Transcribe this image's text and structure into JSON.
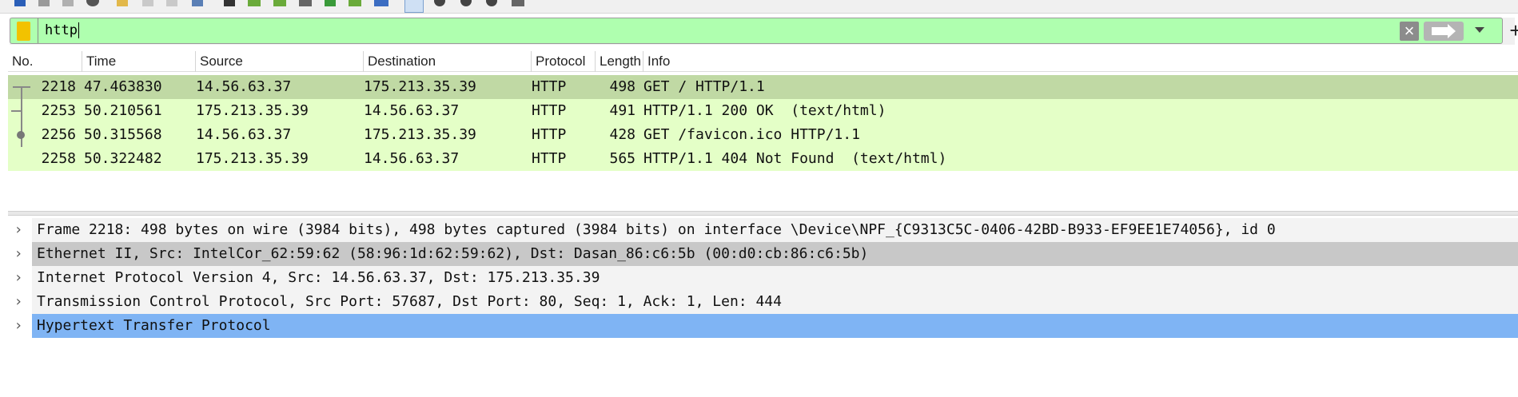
{
  "colors": {
    "filter_valid_bg": "#afffaf",
    "row_http_bg": "#e4ffc7",
    "row_selected_bg": "#c0d9a4",
    "detail_selected_bg": "#7fb4f4",
    "detail_highlight_bg": "#c8c8c8"
  },
  "toolbar": {
    "icons": [
      "shark-fin-icon",
      "stop-icon",
      "restart-icon",
      "options-icon",
      "open-icon",
      "save-icon",
      "close-file-icon",
      "reload-icon",
      "find-icon",
      "go-back-icon",
      "go-forward-icon",
      "go-to-icon",
      "first-packet-icon",
      "last-packet-icon",
      "autoscroll-icon",
      "colorize-icon",
      "zoom-in-icon",
      "zoom-out-icon",
      "zoom-reset-icon",
      "resize-columns-icon"
    ]
  },
  "filter": {
    "value": "http",
    "bookmark_icon": "bookmark-icon",
    "clear_icon": "clear-x-icon",
    "apply_icon": "apply-arrow-icon",
    "dropdown_icon": "chevron-down-icon",
    "add_icon": "plus-icon",
    "add_label": "+"
  },
  "packet_list": {
    "columns": [
      "No.",
      "Time",
      "Source",
      "Destination",
      "Protocol",
      "Length",
      "Info"
    ],
    "rows": [
      {
        "no": "2218",
        "time": "47.463830",
        "source": "14.56.63.37",
        "destination": "175.213.35.39",
        "protocol": "HTTP",
        "length": "498",
        "info": "GET / HTTP/1.1"
      },
      {
        "no": "2253",
        "time": "50.210561",
        "source": "175.213.35.39",
        "destination": "14.56.63.37",
        "protocol": "HTTP",
        "length": "491",
        "info": "HTTP/1.1 200 OK  (text/html)"
      },
      {
        "no": "2256",
        "time": "50.315568",
        "source": "14.56.63.37",
        "destination": "175.213.35.39",
        "protocol": "HTTP",
        "length": "428",
        "info": "GET /favicon.ico HTTP/1.1"
      },
      {
        "no": "2258",
        "time": "50.322482",
        "source": "175.213.35.39",
        "destination": "14.56.63.37",
        "protocol": "HTTP",
        "length": "565",
        "info": "HTTP/1.1 404 Not Found  (text/html)"
      }
    ]
  },
  "details": {
    "expander": "›",
    "rows": [
      "Frame 2218: 498 bytes on wire (3984 bits), 498 bytes captured (3984 bits) on interface \\Device\\NPF_{C9313C5C-0406-42BD-B933-EF9EE1E74056}, id 0",
      "Ethernet II, Src: IntelCor_62:59:62 (58:96:1d:62:59:62), Dst: Dasan_86:c6:5b (00:d0:cb:86:c6:5b)",
      "Internet Protocol Version 4, Src: 14.56.63.37, Dst: 175.213.35.39",
      "Transmission Control Protocol, Src Port: 57687, Dst Port: 80, Seq: 1, Ack: 1, Len: 444",
      "Hypertext Transfer Protocol"
    ]
  }
}
